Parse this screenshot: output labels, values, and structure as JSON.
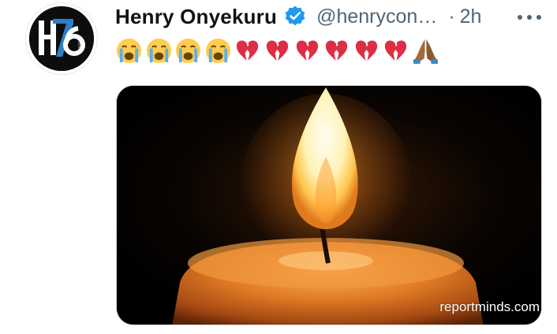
{
  "tweet": {
    "author_name": "Henry Onyekuru",
    "handle": "@henrycon…",
    "separator": "·",
    "time": "2h",
    "verified": true,
    "emojis": [
      "crying-face",
      "crying-face",
      "crying-face",
      "crying-face",
      "broken-heart",
      "broken-heart",
      "broken-heart",
      "broken-heart",
      "broken-heart",
      "broken-heart",
      "folded-hands"
    ]
  },
  "avatar": {
    "logo_text": "H76"
  },
  "media": {
    "watermark": "reportminds.com"
  },
  "colors": {
    "text_primary": "#0f1419",
    "text_secondary": "#536471",
    "verified_blue": "#1d9bf0",
    "border": "#cfd9de"
  },
  "icons": {
    "verified": "verified-badge-icon",
    "more": "more-options-icon"
  }
}
